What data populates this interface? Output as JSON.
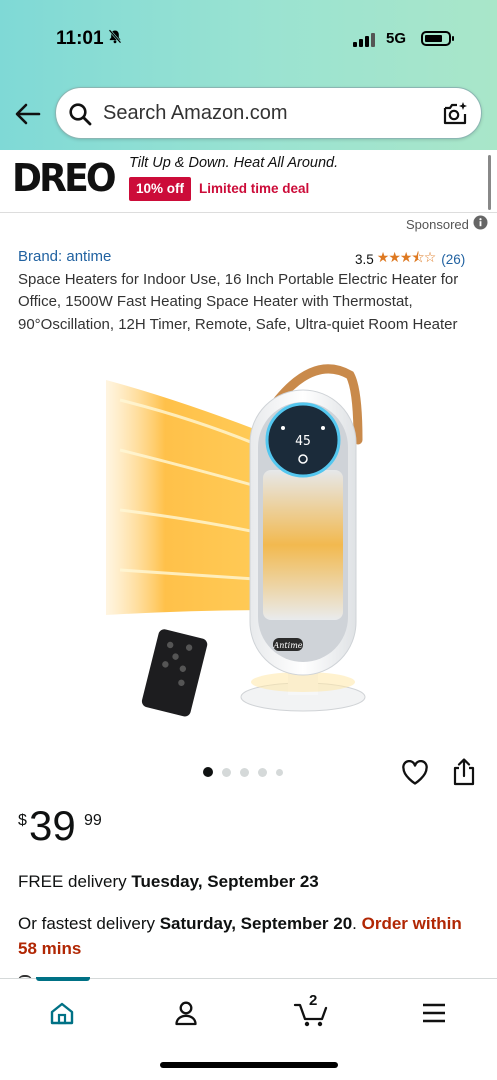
{
  "status_bar": {
    "time": "11:01",
    "network": "5G",
    "icons": [
      "bell-slash-icon",
      "signal-icon",
      "battery-icon"
    ]
  },
  "search": {
    "placeholder": "Search Amazon.com",
    "icons": [
      "back-arrow-icon",
      "search-icon",
      "camera-icon"
    ]
  },
  "ad_banner": {
    "logo_text": "DREO",
    "tagline": "Tilt Up & Down. Heat All Around.",
    "badge": "10% off",
    "deal": "Limited time deal"
  },
  "sponsored": {
    "label": "Sponsored",
    "icon": "info-icon"
  },
  "product": {
    "brand": "Brand: antime",
    "rating_value": "3.5",
    "rating_stars": 3.5,
    "review_count": "(26)",
    "title": "Space Heaters for Indoor Use, 16 Inch Portable Electric Heater for Office, 1500W Fast Heating Space Heater with Thermostat, 90°Oscillation, 12H Timer, Remote, Safe, Ultra-quiet Room Heater",
    "image_display_text": "45",
    "image_brand_text": "Antime",
    "image_count": 5,
    "active_image": 1
  },
  "price": {
    "currency": "$",
    "whole": "39",
    "fraction": "99"
  },
  "delivery": {
    "free_prefix": "FREE delivery ",
    "free_date": "Tuesday, September 23",
    "fast_prefix": "Or fastest delivery ",
    "fast_date": "Saturday, September 20",
    "fast_sep": ". ",
    "order_within": "Order within 58 mins"
  },
  "bottom_nav": {
    "items": [
      "home-icon",
      "account-icon",
      "cart-icon",
      "menu-icon"
    ],
    "cart_count": "2",
    "active": "home"
  },
  "colors": {
    "accent_teal": "#007185",
    "deal_red": "#cc0c39",
    "link_blue": "#2162a1",
    "star_orange": "#de7921",
    "urgent_red": "#b12704"
  }
}
